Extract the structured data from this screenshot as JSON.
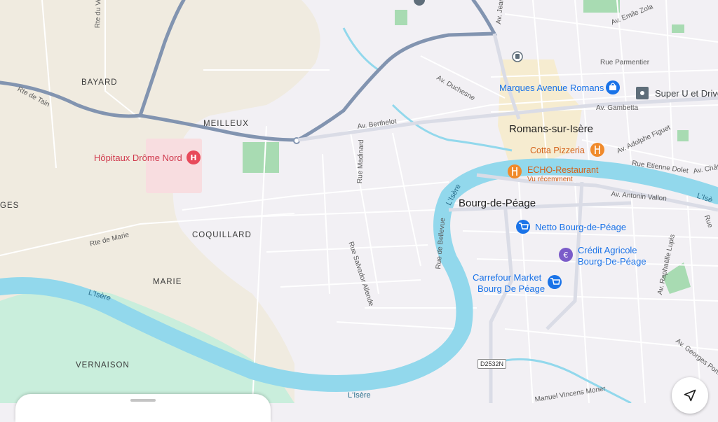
{
  "colors": {
    "land": "#f2f0f4",
    "farmland": "#f0ebe0",
    "forest": "#c9eedc",
    "park": "#a8dbb2",
    "water": "#92d8ec",
    "hospital_area": "#f8dde0",
    "town_center": "#f6ecd0",
    "major_road": "#8294b0",
    "minor_road": "#ffffff"
  },
  "areas": {
    "bayard": "BAYARD",
    "meilleux": "MEILLEUX",
    "coquillard": "COQUILLARD",
    "marie": "MARIE",
    "vernaison": "VERNAISON",
    "ges": "GES"
  },
  "cities": {
    "romans": "Romans-sur-Isère",
    "bourg": "Bourg-de-Péage"
  },
  "streets": {
    "rte_verazier": "Rte du Verazier",
    "rte_tain": "Rte de Tain",
    "av_berthelot": "Av. Berthelot",
    "av_duchesne": "Av. Duchesne",
    "av_jean": "Av. Jean",
    "av_emile_zola": "Av. Emile Zola",
    "rue_parmentier": "Rue Parmentier",
    "av_gambetta": "Av. Gambetta",
    "av_adolphe_figuet": "Av. Adolphe Figuet",
    "rue_etienne_dolet": "Rue Etienne Dolet",
    "av_chat": "Av. Chât",
    "av_antonin_vallon": "Av. Antonin Vallon",
    "rue_madinard": "Rue Madinard",
    "rue_bellevue": "Rue de Bellevue",
    "rue_salvador_allende": "Rue Salvador Allende",
    "rte_marie": "Rte de Marie",
    "av_raphaelle_lupis": "Av. Raphaëlle Lupis",
    "av_georges_pom": "Av. Georges Pom",
    "rue_manuel_vincens": "Manuel Vincens Moner",
    "rue_r": "Rue"
  },
  "rivers": {
    "isere_1": "L'Isère",
    "isere_2": "L'Isère",
    "isere_3": "L'Isère",
    "isere_4": "L'Isè"
  },
  "road_shields": {
    "d2532n": "D2532N"
  },
  "pois": {
    "hospital": {
      "name": "Hôpitaux Drôme Nord",
      "icon": "H"
    },
    "marques": {
      "name": "Marques Avenue Romans",
      "icon": "shopping-bag-icon"
    },
    "superu": {
      "name": "Super U et Drive",
      "icon": "store-icon"
    },
    "cotta": {
      "name": "Cotta Pizzeria",
      "icon": "restaurant-icon"
    },
    "echo": {
      "name": "ECHO-Restaurant",
      "sub": "Vu récemment",
      "icon": "restaurant-icon"
    },
    "netto": {
      "name": "Netto Bourg-de-Péage",
      "icon": "cart-icon"
    },
    "credit": {
      "name_line1": "Crédit Agricole",
      "name_line2": "Bourg-De-Péage",
      "icon": "€"
    },
    "carrefour": {
      "name_line1": "Carrefour Market",
      "name_line2": "Bourg De Péage",
      "icon": "cart-icon"
    }
  }
}
